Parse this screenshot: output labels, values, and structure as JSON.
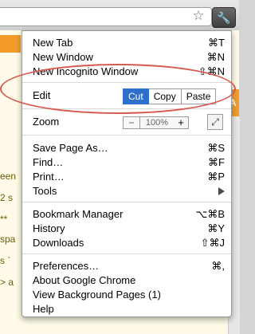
{
  "background": {
    "fragments": [
      "een",
      "2 s",
      "**",
      "spa",
      "s `",
      "> a"
    ]
  },
  "toolbar": {
    "star_icon": "☆",
    "wrench_icon": "🔧"
  },
  "menu": {
    "group1": [
      {
        "label": "New Tab",
        "shortcut": "⌘T"
      },
      {
        "label": "New Window",
        "shortcut": "⌘N"
      },
      {
        "label": "New Incognito Window",
        "shortcut": "⇧⌘N"
      }
    ],
    "edit": {
      "label": "Edit",
      "cut": "Cut",
      "copy": "Copy",
      "paste": "Paste"
    },
    "zoom": {
      "label": "Zoom",
      "minus": "−",
      "value": "100%",
      "plus": "+",
      "fullscreen_icon": "⤢"
    },
    "group2": [
      {
        "label": "Save Page As…",
        "shortcut": "⌘S"
      },
      {
        "label": "Find…",
        "shortcut": "⌘F"
      },
      {
        "label": "Print…",
        "shortcut": "⌘P"
      },
      {
        "label": "Tools",
        "shortcut": ""
      }
    ],
    "group3": [
      {
        "label": "Bookmark Manager",
        "shortcut": "⌥⌘B"
      },
      {
        "label": "History",
        "shortcut": "⌘Y"
      },
      {
        "label": "Downloads",
        "shortcut": "⇧⌘J"
      }
    ],
    "group4": [
      {
        "label": "Preferences…",
        "shortcut": "⌘,"
      },
      {
        "label": "About Google Chrome",
        "shortcut": ""
      },
      {
        "label": "View Background Pages (1)",
        "shortcut": ""
      },
      {
        "label": "Help",
        "shortcut": ""
      }
    ]
  },
  "colors": {
    "highlight": "#2f6fcc",
    "annotation_circle": "#d65a4f",
    "page_accent": "#f39c2b"
  }
}
